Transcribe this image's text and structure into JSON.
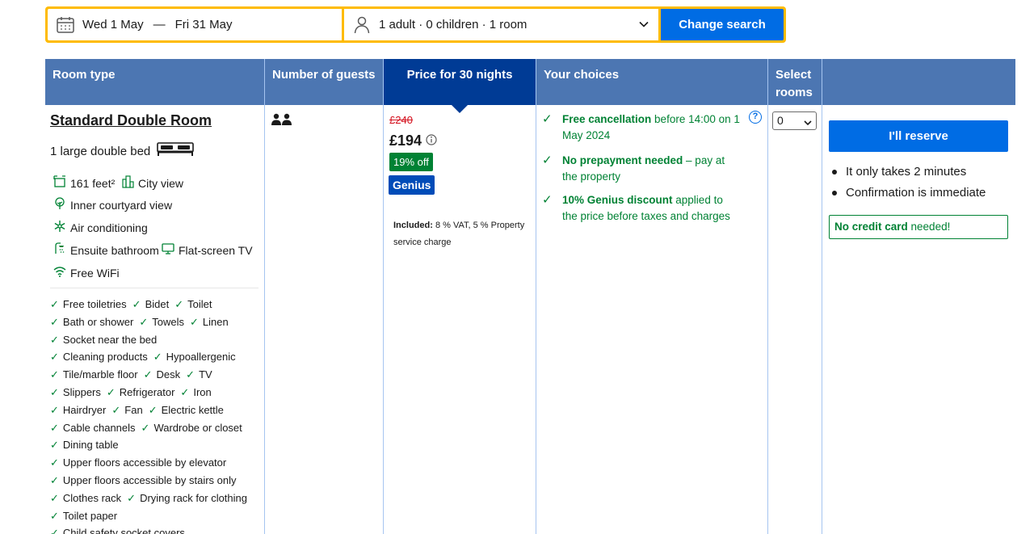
{
  "search": {
    "date_from": "Wed 1 May",
    "date_sep": "—",
    "date_to": "Fri 31 May",
    "guests": "1 adult · 0 children · 1 room",
    "change_label": "Change search",
    "icons": [
      "calendar-icon",
      "person-icon",
      "chevron-down-icon"
    ]
  },
  "table": {
    "headers": {
      "room_type": "Room type",
      "guests": "Number of guests",
      "price": "Price for 30 nights",
      "choices": "Your choices",
      "select": "Select rooms"
    }
  },
  "room": {
    "title": "Standard Double Room",
    "bed": "1 large double bed",
    "size": "161 feet²",
    "view_city": "City view",
    "view_courtyard": "Inner courtyard view",
    "air": "Air conditioning",
    "bath": "Ensuite bathroom",
    "tv": "Flat-screen TV",
    "wifi": "Free WiFi",
    "amenities": [
      [
        "Free toiletries",
        "Bidet",
        "Toilet"
      ],
      [
        "Bath or shower",
        "Towels",
        "Linen"
      ],
      [
        "Socket near the bed"
      ],
      [
        "Cleaning products",
        "Hypoallergenic"
      ],
      [
        "Tile/marble floor",
        "Desk",
        "TV"
      ],
      [
        "Slippers",
        "Refrigerator",
        "Iron"
      ],
      [
        "Hairdryer",
        "Fan",
        "Electric kettle"
      ],
      [
        "Cable channels",
        "Wardrobe or closet"
      ],
      [
        "Dining table"
      ],
      [
        "Upper floors accessible by elevator"
      ],
      [
        "Upper floors accessible by stairs only"
      ],
      [
        "Clothes rack",
        "Drying rack for clothing"
      ],
      [
        "Toilet paper"
      ],
      [
        "Child safety socket covers"
      ]
    ]
  },
  "price": {
    "old": "£240",
    "new": "£194",
    "discount": "19% off",
    "genius": "Genius",
    "included_label": "Included:",
    "included_text": " 8 % VAT, 5 % Property service charge"
  },
  "choices": [
    {
      "bold": "Free cancellation",
      "rest": " before 14:00 on 1 May 2024"
    },
    {
      "bold": "No prepayment needed",
      "rest": " – pay at the property"
    },
    {
      "bold": "10% Genius discount",
      "rest": " applied to the price before taxes and charges"
    }
  ],
  "select": {
    "value": "0"
  },
  "reserve": {
    "button": "I'll reserve",
    "bullets": [
      "It only takes 2 minutes",
      "Confirmation is immediate"
    ],
    "nocc_bold": "No credit card",
    "nocc_rest": " needed!"
  },
  "colors": {
    "search_border": "#febb02",
    "primary_blue": "#006ce4",
    "header_blue": "#4c76b2",
    "header_dark": "#003b95",
    "green": "#008234",
    "red": "#d4111e"
  }
}
